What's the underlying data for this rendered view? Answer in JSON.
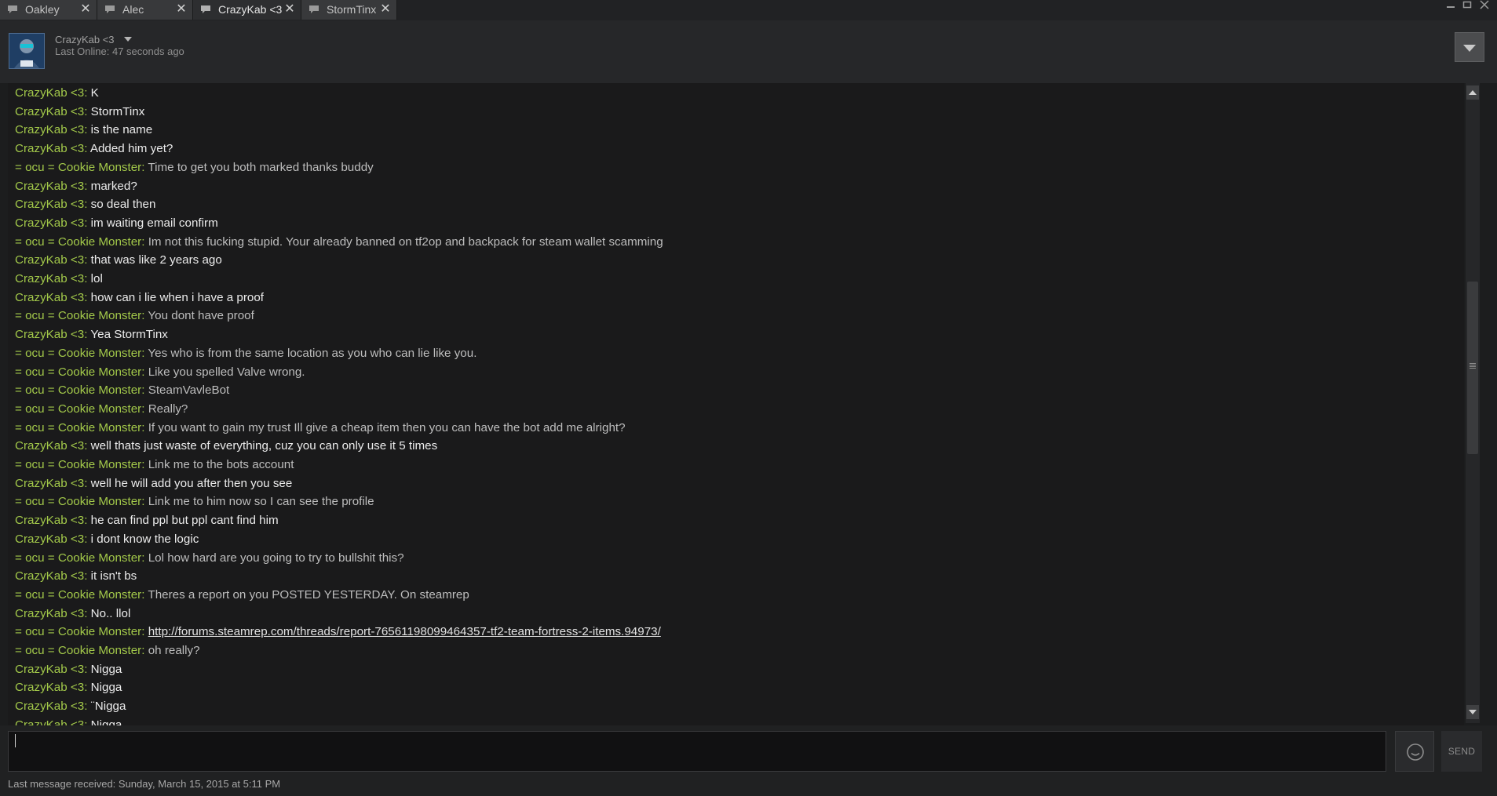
{
  "tabs": [
    {
      "label": "Oakley",
      "active": false
    },
    {
      "label": "Alec",
      "active": false
    },
    {
      "label": "CrazyKab <3",
      "active": true
    },
    {
      "label": "StormTinx",
      "active": false
    }
  ],
  "tab_close_glyph": "✕",
  "header": {
    "friend_name": "CrazyKab <3",
    "last_online": "Last Online: 47 seconds ago"
  },
  "sender_names": {
    "them": "CrazyKab <3",
    "me": "= ocu = Cookie Monster"
  },
  "name_separator": ": ",
  "messages": [
    {
      "from": "them",
      "text": "K"
    },
    {
      "from": "them",
      "text": "StormTinx"
    },
    {
      "from": "them",
      "text": "is the name"
    },
    {
      "from": "them",
      "text": "Added him yet?"
    },
    {
      "from": "me",
      "text": "Time to get you both marked thanks buddy"
    },
    {
      "from": "them",
      "text": "marked?"
    },
    {
      "from": "them",
      "text": "so deal then"
    },
    {
      "from": "them",
      "text": "im waiting email confirm"
    },
    {
      "from": "me",
      "text": "Im not this fucking stupid. Your already banned on tf2op and backpack for steam wallet scamming"
    },
    {
      "from": "them",
      "text": "that was like 2 years ago"
    },
    {
      "from": "them",
      "text": "lol"
    },
    {
      "from": "them",
      "text": "how can i lie when i have a proof"
    },
    {
      "from": "me",
      "text": "You dont have proof"
    },
    {
      "from": "them",
      "text": "Yea StormTinx"
    },
    {
      "from": "me",
      "text": "Yes who is from the same location as you who can lie like you."
    },
    {
      "from": "me",
      "text": "Like you spelled Valve wrong."
    },
    {
      "from": "me",
      "text": "SteamVavleBot"
    },
    {
      "from": "me",
      "text": "Really?"
    },
    {
      "from": "me",
      "text": "If you want to gain my trust Ill give a cheap item then you can have the bot add me alright?"
    },
    {
      "from": "them",
      "text": "well thats just waste of everything, cuz you can only use it 5 times"
    },
    {
      "from": "me",
      "text": "Link me to the bots account"
    },
    {
      "from": "them",
      "text": "well he will add you after then you see"
    },
    {
      "from": "me",
      "text": "Link me to him now so I can see the profile"
    },
    {
      "from": "them",
      "text": "he can find ppl but ppl cant find him"
    },
    {
      "from": "them",
      "text": "i dont know the logic"
    },
    {
      "from": "me",
      "text": "Lol how hard are you going to try to bullshit this?"
    },
    {
      "from": "them",
      "text": "it isn't bs"
    },
    {
      "from": "me",
      "text": "Theres a report on you POSTED YESTERDAY. On steamrep"
    },
    {
      "from": "them",
      "text": "No.. llol"
    },
    {
      "from": "me",
      "text": "http://forums.steamrep.com/threads/report-76561198099464357-tf2-team-fortress-2-items.94973/",
      "link": true
    },
    {
      "from": "me",
      "text": "oh really?"
    },
    {
      "from": "them",
      "text": "Nigga"
    },
    {
      "from": "them",
      "text": "Nigga"
    },
    {
      "from": "them",
      "text": "¨Nigga"
    },
    {
      "from": "them",
      "text": "Nigga"
    }
  ],
  "input": {
    "value": "",
    "placeholder": ""
  },
  "send_label": "SEND",
  "status_text": "Last message received: Sunday, March 15, 2015 at 5:11 PM",
  "colors": {
    "sender_name": "#a3c94a",
    "their_text": "#ececec",
    "my_text": "#bdbdbd",
    "background": "#1a1a1b"
  }
}
